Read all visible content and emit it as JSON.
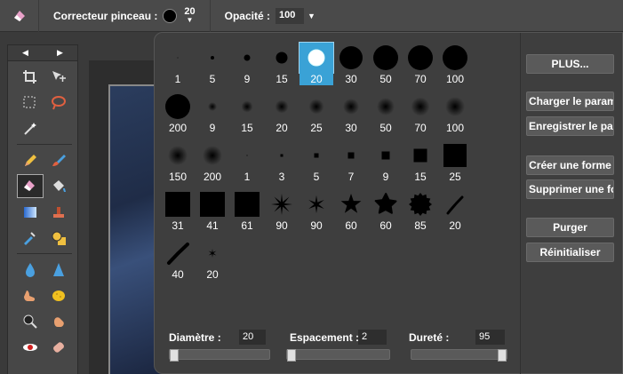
{
  "topbar": {
    "tool_icon": "eraser-icon",
    "brush_label": "Correcteur pinceau :",
    "brush_size": "20",
    "opacity_label": "Opacité :",
    "opacity_value": "100"
  },
  "toolbox": {
    "icons": [
      "crop-icon",
      "move-icon",
      "rect-select-icon",
      "lasso-icon",
      "magic-wand-icon",
      "pencil-icon",
      "brush-icon",
      "eraser-icon",
      "bucket-icon",
      "gradient-icon",
      "stamp-icon",
      "replace-color-icon",
      "shapes-icon",
      "blur-icon",
      "sharpen-icon",
      "smudge-icon",
      "sponge-icon",
      "dodge-icon",
      "burn-icon",
      "red-eye-icon",
      "spot-heal-icon"
    ]
  },
  "brushes": {
    "rows": [
      [
        {
          "label": "1",
          "kind": "soft",
          "d": 1
        },
        {
          "label": "5",
          "kind": "soft",
          "d": 4
        },
        {
          "label": "9",
          "kind": "soft",
          "d": 7
        },
        {
          "label": "15",
          "kind": "soft",
          "d": 13
        },
        {
          "label": "20",
          "kind": "hard-sel",
          "d": 18
        },
        {
          "label": "30",
          "kind": "soft",
          "d": 26
        },
        {
          "label": "50",
          "kind": "soft",
          "d": 28
        },
        {
          "label": "70",
          "kind": "soft",
          "d": 28
        },
        {
          "label": "100",
          "kind": "soft",
          "d": 28
        },
        {
          "label": "200",
          "kind": "soft",
          "d": 28
        }
      ],
      [
        {
          "label": "9",
          "kind": "fuzzy",
          "d": 6
        },
        {
          "label": "15",
          "kind": "fuzzy",
          "d": 9
        },
        {
          "label": "20",
          "kind": "fuzzy",
          "d": 11
        },
        {
          "label": "25",
          "kind": "fuzzy",
          "d": 13
        },
        {
          "label": "30",
          "kind": "fuzzy",
          "d": 14
        },
        {
          "label": "50",
          "kind": "fuzzy",
          "d": 16
        },
        {
          "label": "70",
          "kind": "fuzzy",
          "d": 17
        },
        {
          "label": "100",
          "kind": "fuzzy",
          "d": 18
        },
        {
          "label": "150",
          "kind": "fuzzy",
          "d": 18
        },
        {
          "label": "200",
          "kind": "fuzzy",
          "d": 18
        }
      ],
      [
        {
          "label": "1",
          "kind": "square",
          "d": 1
        },
        {
          "label": "3",
          "kind": "square",
          "d": 3
        },
        {
          "label": "5",
          "kind": "square",
          "d": 5
        },
        {
          "label": "7",
          "kind": "square",
          "d": 7
        },
        {
          "label": "9",
          "kind": "square",
          "d": 9
        },
        {
          "label": "15",
          "kind": "square",
          "d": 15
        },
        {
          "label": "25",
          "kind": "square",
          "d": 26
        },
        {
          "label": "31",
          "kind": "square",
          "d": 28
        },
        {
          "label": "41",
          "kind": "square",
          "d": 28
        },
        {
          "label": "61",
          "kind": "square",
          "d": 28
        }
      ],
      [
        {
          "label": "90",
          "kind": "star8",
          "d": 24
        },
        {
          "label": "90",
          "kind": "star6",
          "d": 20
        },
        {
          "label": "60",
          "kind": "star5",
          "d": 24
        },
        {
          "label": "60",
          "kind": "splat",
          "d": 24
        },
        {
          "label": "85",
          "kind": "gear",
          "d": 26
        },
        {
          "label": "20",
          "kind": "stroke",
          "d": 18
        },
        {
          "label": "40",
          "kind": "stroke2",
          "d": 22
        },
        {
          "label": "20",
          "kind": "tinystar",
          "d": 10
        }
      ]
    ]
  },
  "side_buttons": {
    "plus": "PLUS...",
    "load": "Charger le parame",
    "save": "Enregistrer le para",
    "create": "Créer une forme",
    "delete": "Supprimer une for",
    "purge": "Purger",
    "reset": "Réinitialiser"
  },
  "sliders": {
    "diameter_label": "Diamètre :",
    "diameter_value": "20",
    "spacing_label": "Espacement :",
    "spacing_value": "2",
    "hardness_label": "Dureté :",
    "hardness_value": "95",
    "diameter_level": 0.0,
    "spacing_level": 0.0,
    "hardness_level": 1.0
  }
}
